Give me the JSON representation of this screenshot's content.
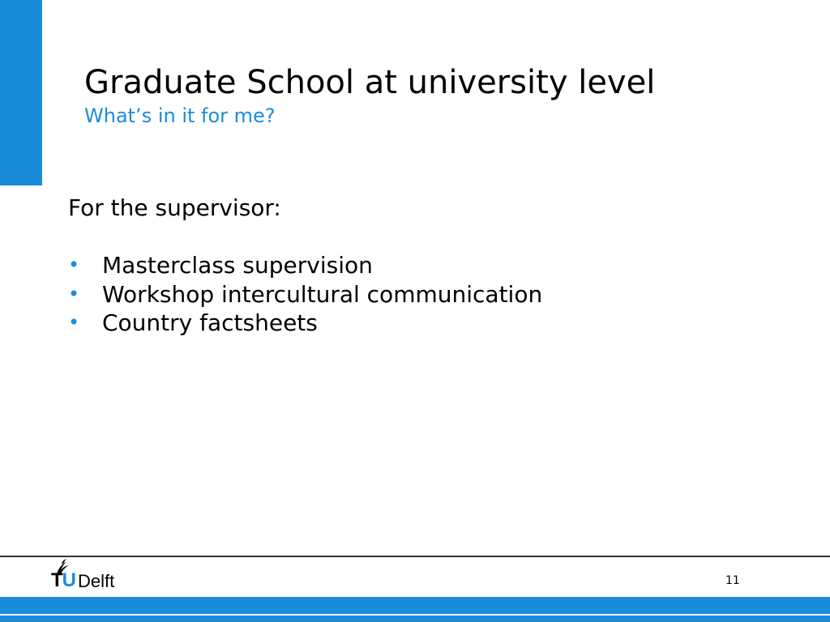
{
  "colors": {
    "accent": "#1A8CDA",
    "text": "#000000"
  },
  "slide": {
    "title": "Graduate School at university level",
    "subtitle": "What’s in it for me?",
    "intro": "For the supervisor:",
    "bullet_glyph": "•",
    "bullets": [
      "Masterclass supervision",
      "Workshop intercultural communication",
      "Country factsheets"
    ]
  },
  "footer": {
    "logo": {
      "icon": "flame-icon",
      "t": "T",
      "u": "U",
      "name": "Delft"
    },
    "page_number": "11"
  }
}
